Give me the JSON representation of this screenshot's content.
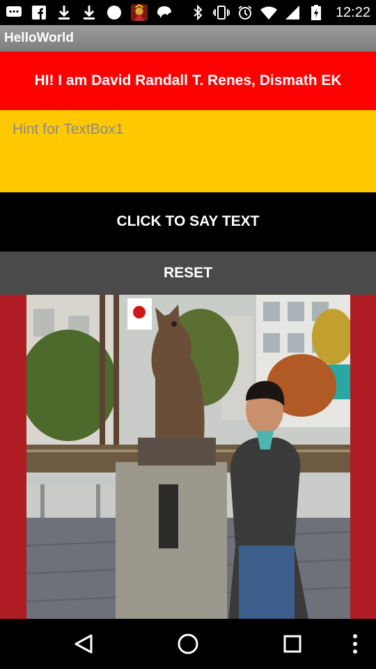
{
  "status_bar": {
    "time": "12:22",
    "left_icons": [
      "chat-icon",
      "facebook-icon",
      "download-icon",
      "download-icon",
      "circle-icon",
      "game-icon",
      "snapchat-icon"
    ],
    "right_icons": [
      "bluetooth-icon",
      "vibrate-icon",
      "alarm-icon",
      "wifi-icon",
      "signal-icon",
      "battery-icon"
    ]
  },
  "app": {
    "title": "HelloWorld"
  },
  "main": {
    "greeting": "HI! I am David Randall T. Renes, Dismath EK",
    "textbox_hint": "Hint for TextBox1",
    "say_button": "CLICK TO SAY TEXT",
    "reset_button": "RESET"
  },
  "colors": {
    "greeting_bg": "#ff0000",
    "textbox_bg": "#ffc800",
    "say_bg": "#000000",
    "reset_bg": "#4a4a4a",
    "photo_frame": "#b01c24"
  },
  "nav_bar": {
    "icons": [
      "back-icon",
      "home-icon",
      "recents-icon",
      "overflow-menu-icon"
    ]
  }
}
